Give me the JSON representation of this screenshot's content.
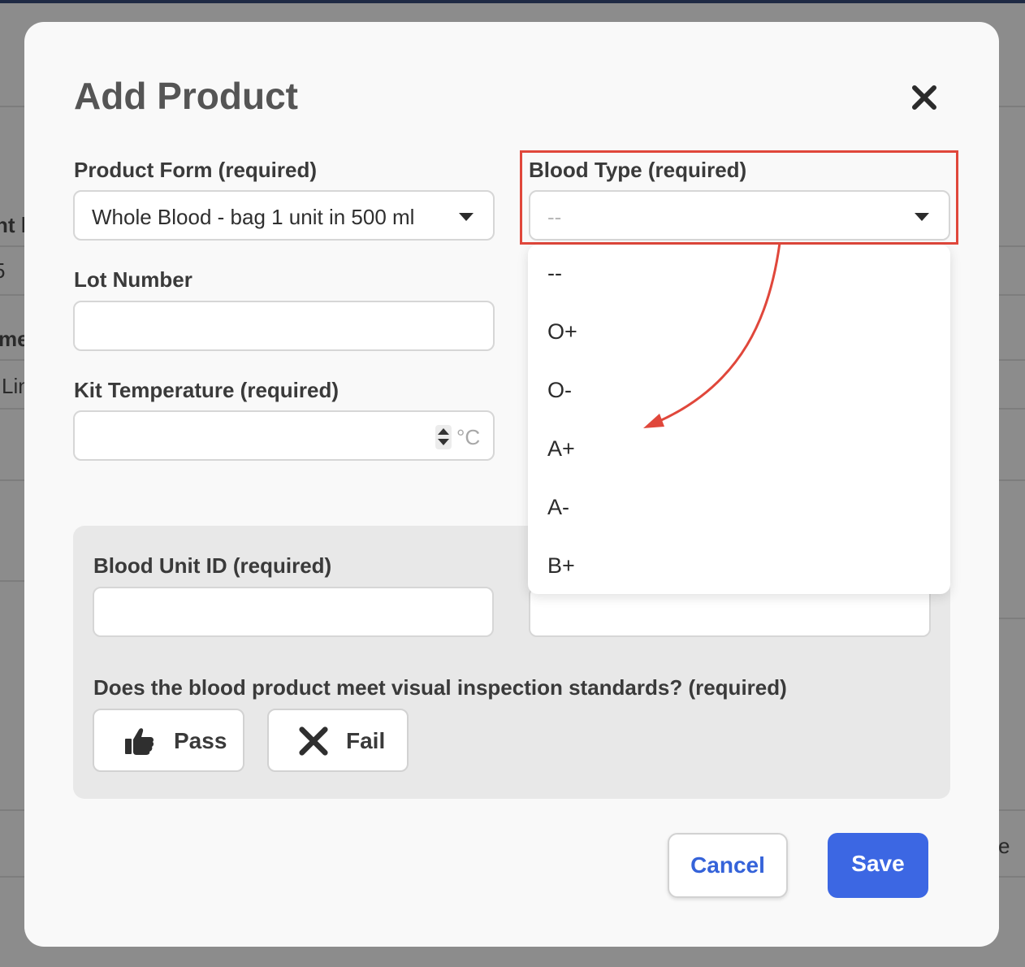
{
  "background_page": {
    "fragments": [
      "nt l",
      "5",
      "me",
      "Lin",
      "e"
    ]
  },
  "modal": {
    "title": "Add Product"
  },
  "product_form": {
    "label": "Product Form (required)",
    "selected": "Whole Blood - bag 1 unit in 500 ml"
  },
  "blood_type": {
    "label": "Blood Type (required)",
    "placeholder": "--",
    "options": [
      "--",
      "O+",
      "O-",
      "A+",
      "A-",
      "B+"
    ]
  },
  "lot_number": {
    "label": "Lot Number",
    "value": ""
  },
  "kit_temperature": {
    "label": "Kit Temperature (required)",
    "value": "",
    "unit": "°C"
  },
  "blood_unit_id": {
    "label": "Blood Unit ID (required)",
    "value": ""
  },
  "inspection": {
    "question": "Does the blood product meet visual inspection standards? (required)",
    "pass_label": "Pass",
    "fail_label": "Fail"
  },
  "actions": {
    "cancel_label": "Cancel",
    "save_label": "Save"
  },
  "colors": {
    "highlight": "#e0473b",
    "primary": "#3c67e3",
    "cancel_text": "#3563d9"
  },
  "icons": {
    "close": "close-icon",
    "pass": "thumbs-up-icon",
    "fail": "x-icon",
    "dropdown": "caret-down-icon",
    "spinner": "number-spinner-icon"
  }
}
